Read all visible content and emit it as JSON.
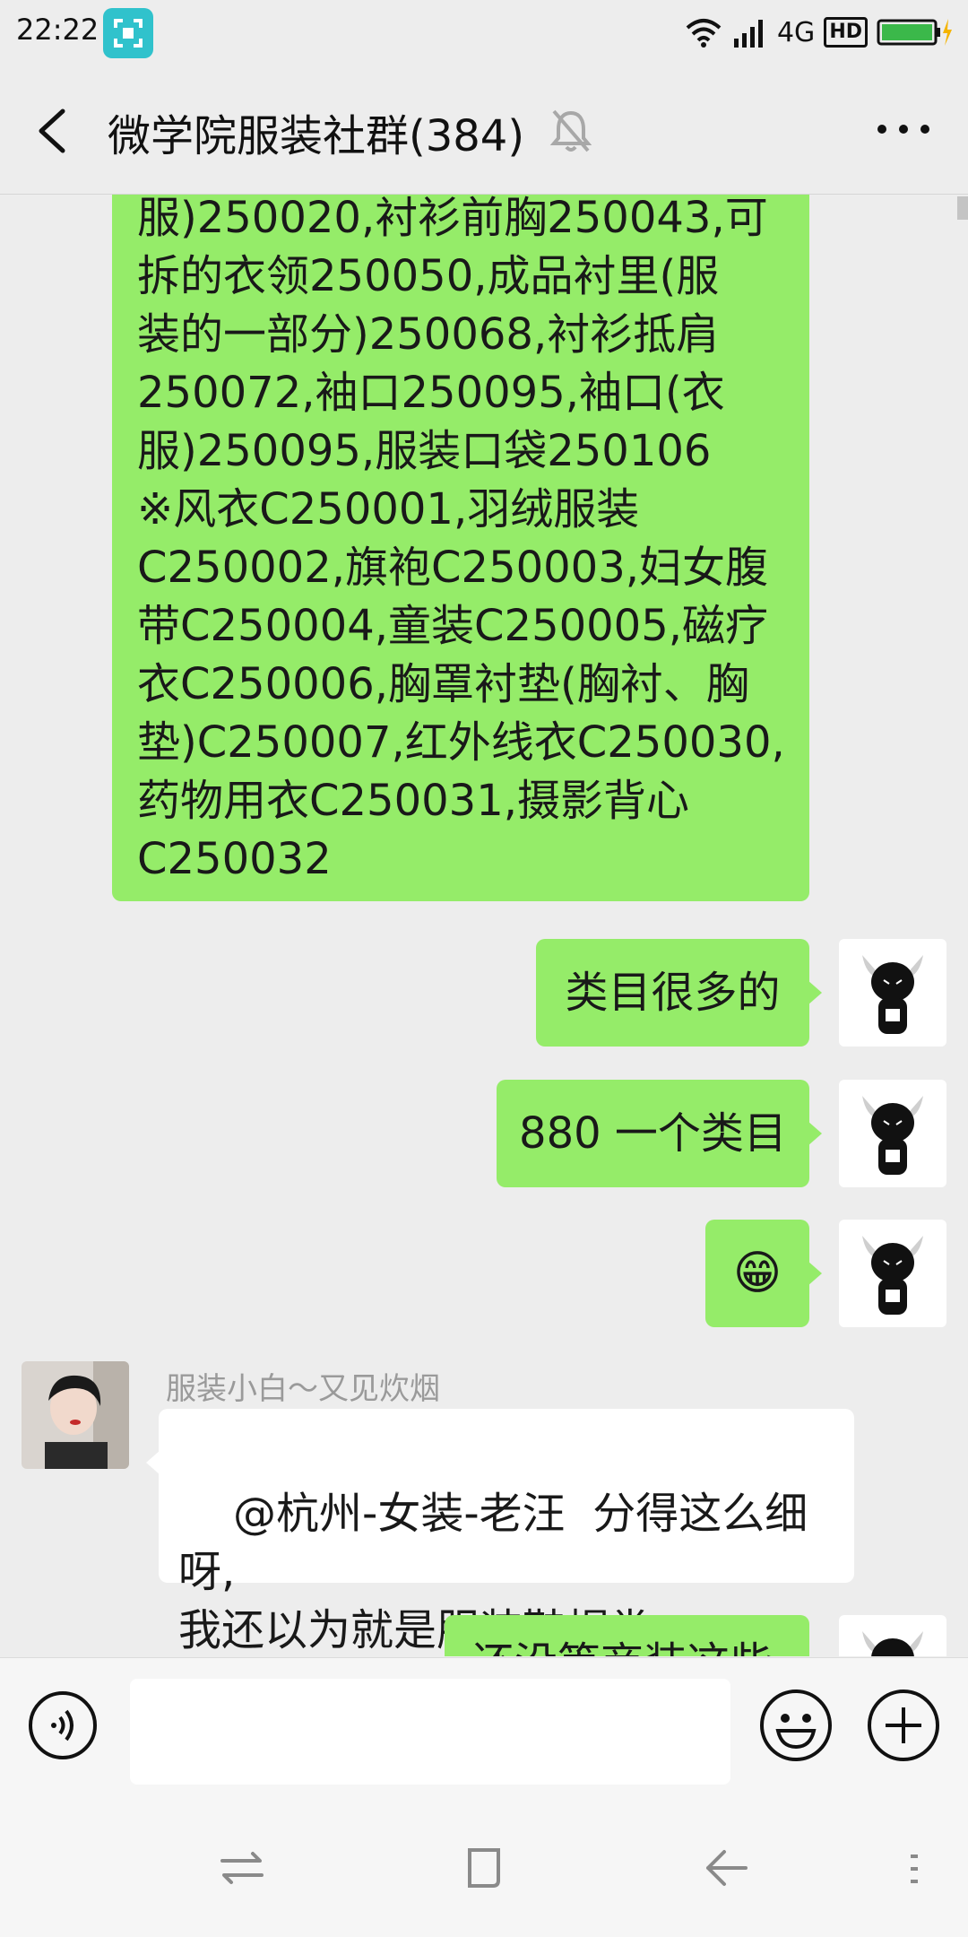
{
  "status_bar": {
    "time": "22:22",
    "network": "4G",
    "hd": "HD",
    "icons": [
      "screenshot-icon",
      "wifi-icon",
      "signal-icon",
      "battery-charging-icon"
    ],
    "colors": {
      "screenshot_badge": "#30c2cc",
      "battery": "#3bb84a",
      "charging": "#f5b400"
    }
  },
  "header": {
    "title": "微学院服装社群(384)",
    "icons": [
      "back-icon",
      "mute-bell-icon",
      "more-icon"
    ]
  },
  "messages": [
    {
      "side": "self",
      "type": "text",
      "text": "服)250020,衬衫前胸250043,可\n拆的衣领250050,成品衬里(服\n装的一部分)250068,衬衫抵肩\n250072,袖口250095,袖口(衣\n服)250095,服装口袋250106\n※风衣C250001,羽绒服装\nC250002,旗袍C250003,妇女腹\n带C250004,童装C250005,磁疗\n衣C250006,胸罩衬垫(胸衬、胸\n垫)C250007,红外线衣C250030,\n药物用衣C250031,摄影背心\nC250032"
    },
    {
      "side": "self",
      "type": "text",
      "text": "类目很多的"
    },
    {
      "side": "self",
      "type": "text",
      "text": "880 一个类目"
    },
    {
      "side": "self",
      "type": "emoji",
      "emoji": "😁"
    },
    {
      "side": "other",
      "type": "text",
      "sender": "服装小白～又见炊烟",
      "text": "@杭州-女装-老汪  分得这么细呀,\n我还以为就是服装鞋帽类"
    },
    {
      "side": "self",
      "type": "text",
      "text": "还没等商装这些",
      "partially_visible": true
    }
  ],
  "input_bar": {
    "placeholder": "",
    "icons": [
      "voice-icon",
      "emoji-icon",
      "plus-icon"
    ]
  },
  "nav_bar": {
    "icons": [
      "switch-apps-icon",
      "home-square-icon",
      "back-arrow-icon",
      "menu-dots-icon"
    ]
  },
  "colors": {
    "background": "#ededed",
    "self_bubble": "#95ec69",
    "other_bubble": "#ffffff",
    "sender_name": "#9a9a9a"
  }
}
